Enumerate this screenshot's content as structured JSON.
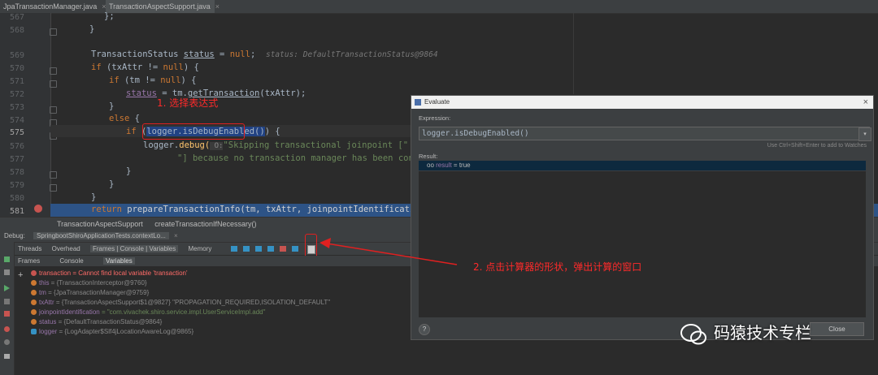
{
  "tabs": [
    {
      "label": "JpaTransactionManager.java",
      "close": "×"
    },
    {
      "label": "TransactionAspectSupport.java",
      "close": "×"
    }
  ],
  "editor": {
    "line_numbers": [
      "567",
      "568",
      "569",
      "570",
      "571",
      "572",
      "573",
      "574",
      "575",
      "576",
      "577",
      "578",
      "579",
      "580",
      "581"
    ],
    "l567": "};",
    "l568": "}",
    "l570_a": "TransactionStatus ",
    "l570_b": "status",
    "l570_c": " = ",
    "l570_d": "null",
    "l570_e": ";  ",
    "l570_hint": "status: DefaultTransactionStatus@9864",
    "l571_kw": "if",
    "l571_rest": " (txAttr != ",
    "l571_null": "null",
    "l571_end": ") {",
    "l572_kw": "if",
    "l572_rest": " (tm != ",
    "l572_null": "null",
    "l572_end": ") {",
    "l573_a": "status",
    "l573_b": " = tm.",
    "l573_c": "getTransaction",
    "l573_d": "(txAttr);",
    "l574": "}",
    "l575_kw": "else",
    "l575_end": " {",
    "l576_kw": "if",
    "l576_mid": " (",
    "l576_sel": "logger.isDebugEnabled()",
    "l576_end": ") {",
    "l577_a": "logger.",
    "l577_b": "debug(",
    "l577_c": " O:",
    "l577_d": "\"Skipping transactional joinpoint [\" + joinpoi",
    "l578": "\"] because no transaction manager has been configured\"",
    "l579": "}",
    "l580": "}",
    "l581": "}",
    "l582_kw": "return ",
    "l582_rest": "prepareTransactionInfo(tm, txAttr, joinpointIdentification, status);"
  },
  "breadcrumb": [
    "TransactionAspectSupport",
    "createTransactionIfNecessary()"
  ],
  "debug": {
    "label": "Debug:",
    "session": "SpringbootShiroApplicationTests.contextLo...",
    "threads": "Threads",
    "overhead": "Overhead",
    "frames_console_vars": "Frames | Console | Variables",
    "memory": "Memory",
    "frames_tab": "Frames",
    "console_tab": "Console",
    "variables_tab": "Variables"
  },
  "variables": [
    {
      "name": "transaction",
      "value": " = Cannot find local variable 'transaction'",
      "error": true
    },
    {
      "name": "this",
      "value": " = {TransactionInterceptor@9760}"
    },
    {
      "name": "tm",
      "value": " = {JpaTransactionManager@9759}"
    },
    {
      "name": "txAttr",
      "value": " = {TransactionAspectSupport$1@9827} \"PROPAGATION_REQUIRED,ISOLATION_DEFAULT\""
    },
    {
      "name": "joinpointIdentification",
      "value": " = \"com.vivachek.shiro.service.impl.UserServiceImpl.add\""
    },
    {
      "name": "status",
      "value": " = {DefaultTransactionStatus@9864}"
    },
    {
      "name": "logger",
      "value": " = {LogAdapter$Slf4jLocationAwareLog@9865}"
    }
  ],
  "dialog": {
    "title": "Evaluate",
    "expression_label": "Expression:",
    "expression": "logger.isDebugEnabled()",
    "hint": "Use Ctrl+Shift+Enter to add to Watches",
    "result_label": "Result:",
    "result_name": "result",
    "result_eq": " = ",
    "result_value": "true",
    "help": "?",
    "close": "Close"
  },
  "annotations": {
    "step1": "1. 选择表达式",
    "step2": "2. 点击计算器的形状，弹出计算的窗口"
  },
  "watermark": "码猿技术专栏",
  "colors": {
    "annotation": "#ff2a2a",
    "selection": "#2d5386",
    "keyword": "#cc7832",
    "string": "#6a8759"
  }
}
